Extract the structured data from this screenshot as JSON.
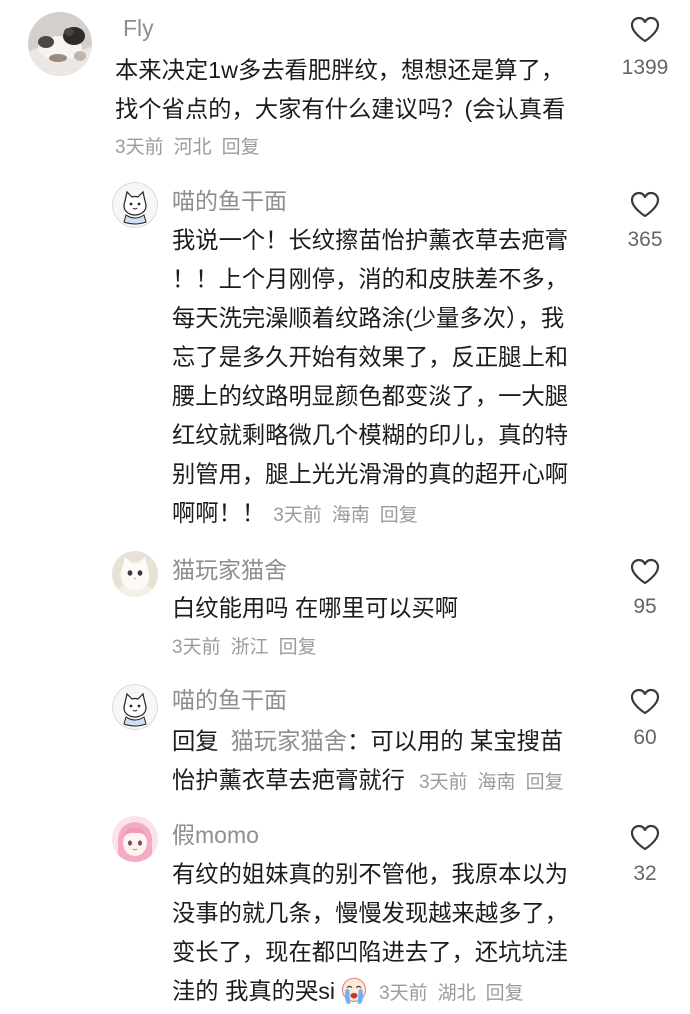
{
  "colors": {
    "text": "#1c1c1c",
    "secondary": "#8e8e8e",
    "meta": "#9b9b9b",
    "count": "#666666",
    "icon": "#3a3a3a"
  },
  "icons": {
    "like": "heart-outline-icon",
    "emoji": "crying-face-emoji"
  },
  "comments": [
    {
      "username": "Fly",
      "lines": [
        "本来决定1w多去看肥胖纹，想想还是算了，",
        "找个省点的，大家有什么建议吗？(会认真看"
      ],
      "time": "3天前",
      "location": "河北",
      "reply_label": "回复",
      "likes": "1399"
    },
    {
      "username": "喵的鱼干面",
      "lines": [
        "我说一个！长纹擦苗怡护薰衣草去疤膏",
        "！！上个月刚停，消的和皮肤差不多，",
        "每天洗完澡顺着纹路涂(少量多次），我",
        "忘了是多久开始有效果了，反正腿上和",
        "腰上的纹路明显颜色都变淡了，一大腿",
        "红纹就剩略微几个模糊的印儿，真的特",
        "别管用，腿上光光滑滑的真的超开心啊",
        "啊啊！！"
      ],
      "time": "3天前",
      "location": "海南",
      "reply_label": "回复",
      "likes": "365"
    },
    {
      "username": "猫玩家猫舍",
      "lines": [
        "白纹能用吗 在哪里可以买啊"
      ],
      "time": "3天前",
      "location": "浙江",
      "reply_label": "回复",
      "likes": "95"
    },
    {
      "username": "喵的鱼干面",
      "reply_prefix": "回复",
      "reply_to": "猫玩家猫舍",
      "lines": [
        "：可以用的 某宝搜苗",
        "怡护薰衣草去疤膏就行"
      ],
      "time": "3天前",
      "location": "海南",
      "reply_label": "回复",
      "likes": "60"
    },
    {
      "username": "假momo",
      "lines": [
        "有纹的姐妹真的别不管他，我原本以为",
        "没事的就几条，慢慢发现越来越多了，",
        "变长了，现在都凹陷进去了，还坑坑洼",
        "洼的 我真的哭si"
      ],
      "time": "3天前",
      "location": "湖北",
      "reply_label": "回复",
      "likes": "32"
    }
  ]
}
